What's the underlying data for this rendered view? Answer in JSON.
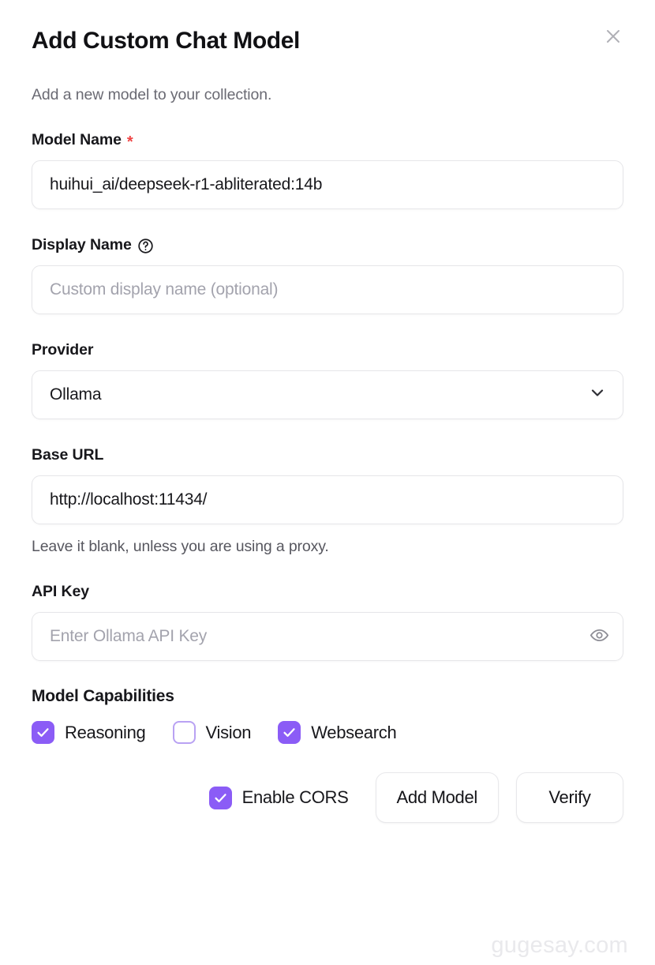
{
  "dialog": {
    "title": "Add Custom Chat Model",
    "subtitle": "Add a new model to your collection.",
    "close_icon": "close-icon"
  },
  "fields": {
    "model_name": {
      "label": "Model Name",
      "required_marker": "*",
      "value": "huihui_ai/deepseek-r1-abliterated:14b"
    },
    "display_name": {
      "label": "Display Name",
      "help_icon": "help-circle-icon",
      "value": "",
      "placeholder": "Custom display name (optional)"
    },
    "provider": {
      "label": "Provider",
      "value": "Ollama",
      "chevron_icon": "chevron-down-icon",
      "options": [
        "Ollama"
      ]
    },
    "base_url": {
      "label": "Base URL",
      "value": "http://localhost:11434/",
      "helper": "Leave it blank, unless you are using a proxy."
    },
    "api_key": {
      "label": "API Key",
      "value": "",
      "placeholder": "Enter Ollama API Key",
      "toggle_icon": "eye-icon"
    }
  },
  "capabilities": {
    "title": "Model Capabilities",
    "items": [
      {
        "label": "Reasoning",
        "checked": true
      },
      {
        "label": "Vision",
        "checked": false
      },
      {
        "label": "Websearch",
        "checked": true
      }
    ]
  },
  "footer": {
    "cors": {
      "label": "Enable CORS",
      "checked": true
    },
    "add_model_label": "Add Model",
    "verify_label": "Verify"
  },
  "watermark": "gugesay.com",
  "colors": {
    "accent_purple": "#8b5cf6",
    "accent_purple_light": "#b9a2f3",
    "required_red": "#ef4444",
    "border_gray": "#e6e6e9",
    "text_primary": "#18181c",
    "text_secondary": "#6a6a73",
    "placeholder": "#a3a3ad"
  }
}
